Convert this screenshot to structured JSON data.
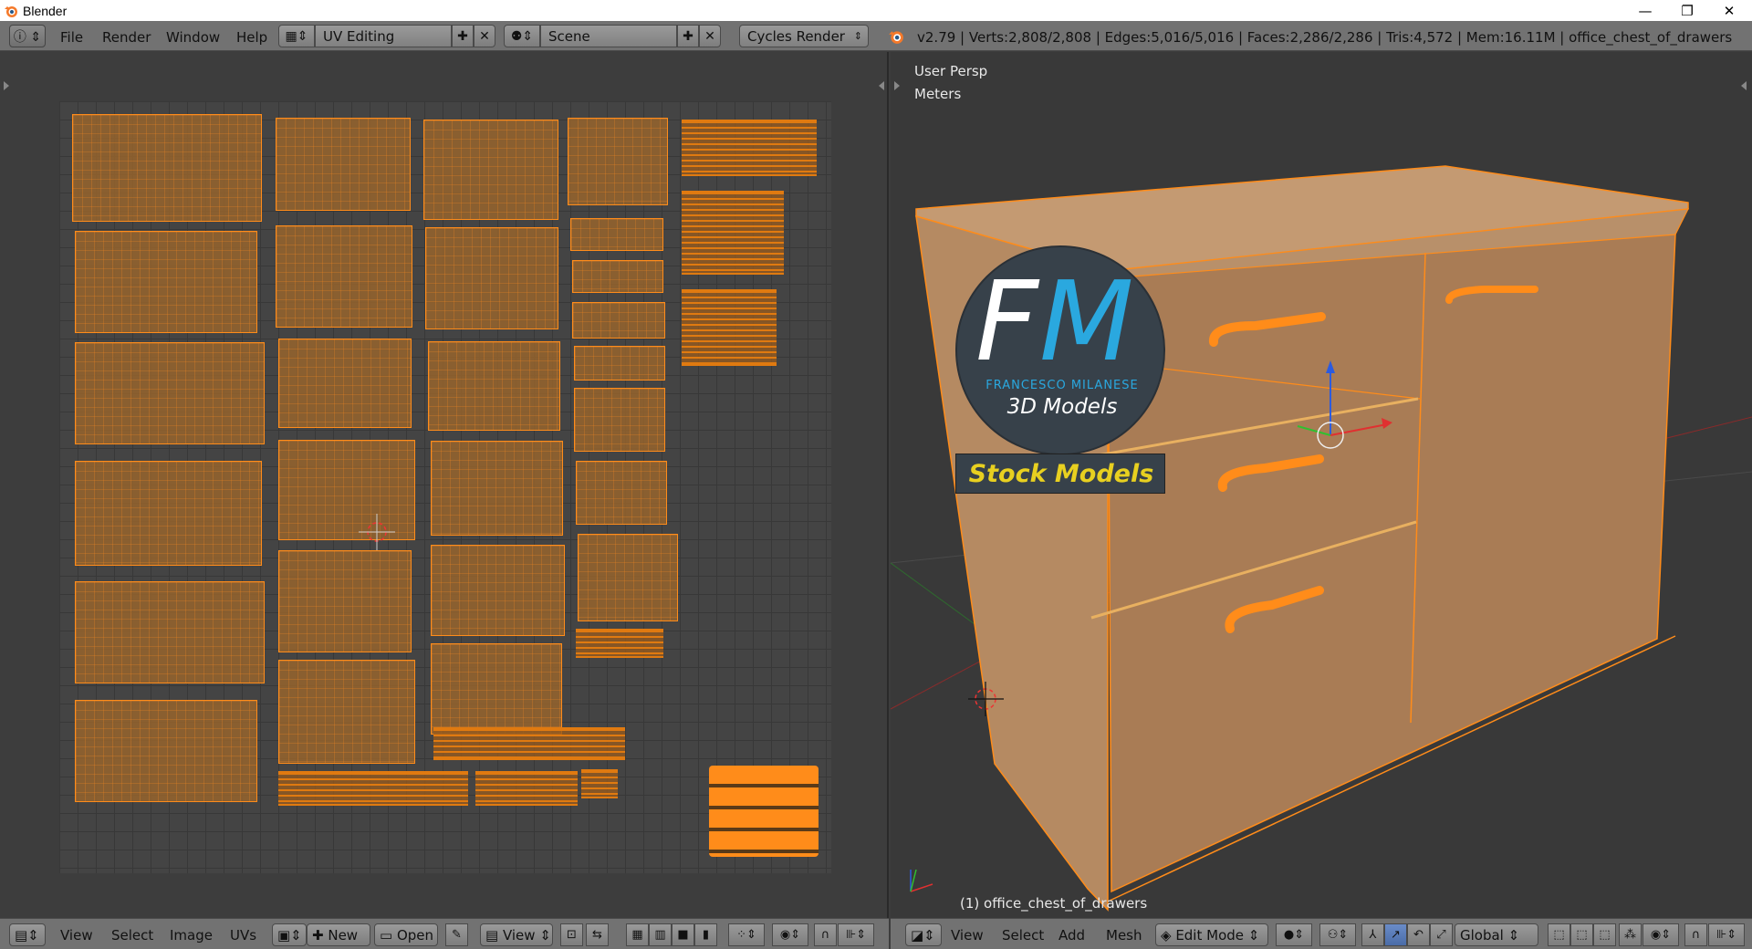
{
  "window": {
    "title": "Blender",
    "minimize": "—",
    "maximize": "❐",
    "close": "✕"
  },
  "info_header": {
    "menus": [
      "File",
      "Render",
      "Window",
      "Help"
    ],
    "layout": "UV Editing",
    "scene": "Scene",
    "engine": "Cycles Render",
    "stats": "v2.79 | Verts:2,808/2,808 | Edges:5,016/5,016 | Faces:2,286/2,286 | Tris:4,572 | Mem:16.11M | office_chest_of_drawers"
  },
  "uv_editor": {
    "menus": [
      "View",
      "Select",
      "Image",
      "UVs"
    ],
    "new_label": "New",
    "open_label": "Open",
    "view_label": "View"
  },
  "viewport": {
    "view_name": "User Persp",
    "units": "Meters",
    "object_label": "(1) office_chest_of_drawers",
    "menus": [
      "View",
      "Select",
      "Add",
      "Mesh"
    ],
    "mode": "Edit Mode",
    "orientation": "Global"
  },
  "watermark": {
    "initials_f": "F",
    "initials_m": "M",
    "brand": "FRANCESCO MILANESE",
    "tagline": "3D Models",
    "banner": "Stock Models"
  },
  "colors": {
    "selection": "#ff8c1a",
    "mesh_face": "#c49a72",
    "header": "#727272",
    "banner_text": "#e8d020"
  }
}
